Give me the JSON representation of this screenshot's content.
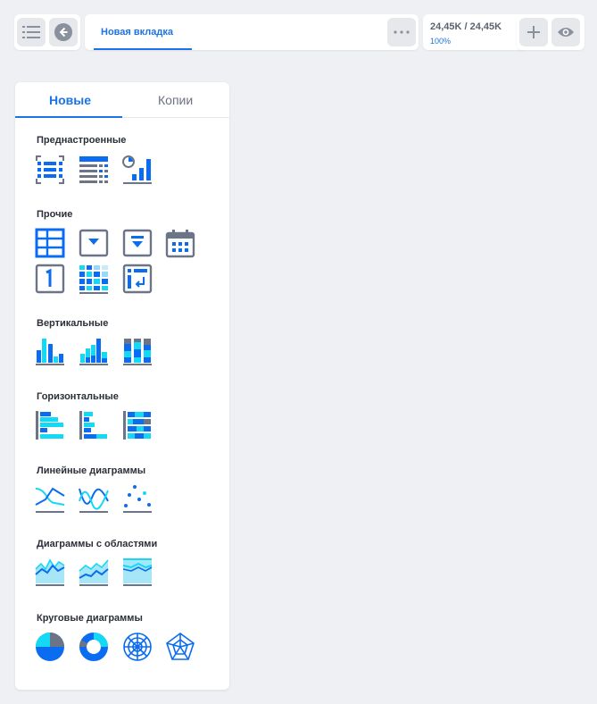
{
  "toolbar": {
    "tab_label": "Новая вкладка",
    "stat_main": "24,45K / 24,45K",
    "stat_sub": "100%"
  },
  "panel": {
    "tabs": [
      "Новые",
      "Копии"
    ],
    "sections": [
      "Преднастроенные",
      "Прочие",
      "Вертикальные",
      "Горизонтальные",
      "Линейные диаграммы",
      "Диаграммы с областями",
      "Круговые диаграммы"
    ]
  },
  "colors": {
    "accent": "#1a73e8",
    "icon_blue": "#0a6cf0",
    "icon_cyan": "#14d9f5",
    "icon_gray": "#6b7587"
  }
}
